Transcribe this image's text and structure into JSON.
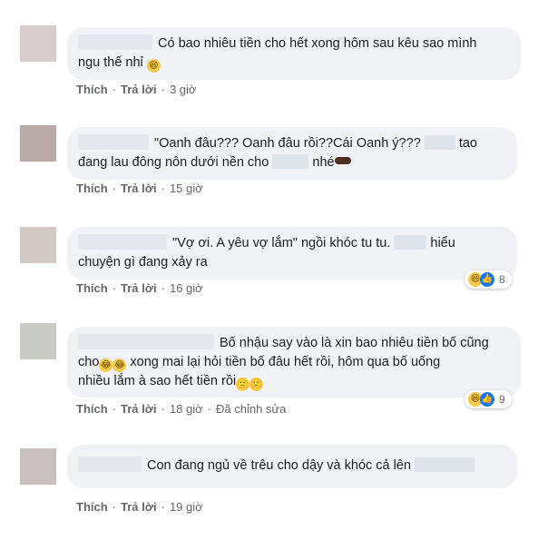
{
  "comments": [
    {
      "text_a": "Có bao nhiêu tiền cho hết xong hôm sau kêu sao mình",
      "text_b": "ngu thế nhỉ",
      "emoji": "laughing-face",
      "like": "Thích",
      "reply": "Trả lời",
      "time": "3 giờ"
    },
    {
      "text_a": "\"Oanh đâu??? Oanh đâu rồi??Cái Oanh ý???",
      "text_a2": "tao",
      "text_b": "đang lau đông nôn dưới nền cho",
      "text_b2": "nhé",
      "emoji": "pointing-hand",
      "like": "Thích",
      "reply": "Trả lời",
      "time": "15 giờ"
    },
    {
      "text_a": "\"Vợ ơi. A yêu vợ lắm\" ngồi khóc tu tu.",
      "text_a2": "hiểu",
      "text_b": "chuyện gì đang xảy ra",
      "like": "Thích",
      "reply": "Trả lời",
      "time": "16 giờ",
      "reaction_count": "8"
    },
    {
      "text_a": "Bố nhậu say vào là xin bao nhiêu tiền bố cũng",
      "text_b": "cho",
      "text_b2": "xong mai lại hỏi tiền bố đâu hết rồi, hôm qua bố uống",
      "text_c": "nhiều lắm à sao hết tiền rồi",
      "like": "Thích",
      "reply": "Trả lời",
      "time": "18 giờ",
      "edited": "Đã chỉnh sửa",
      "reaction_count": "9"
    },
    {
      "text_a": "Con đang ngủ về trêu cho dậy và khóc cả lên",
      "like": "Thích",
      "reply": "Trả lời",
      "time": "19 giờ"
    }
  ],
  "colors": {
    "bubble": "#f0f2f5",
    "meta": "#65676b",
    "like_blue": "#1877f2",
    "haha_yellow": "#f7c948"
  }
}
